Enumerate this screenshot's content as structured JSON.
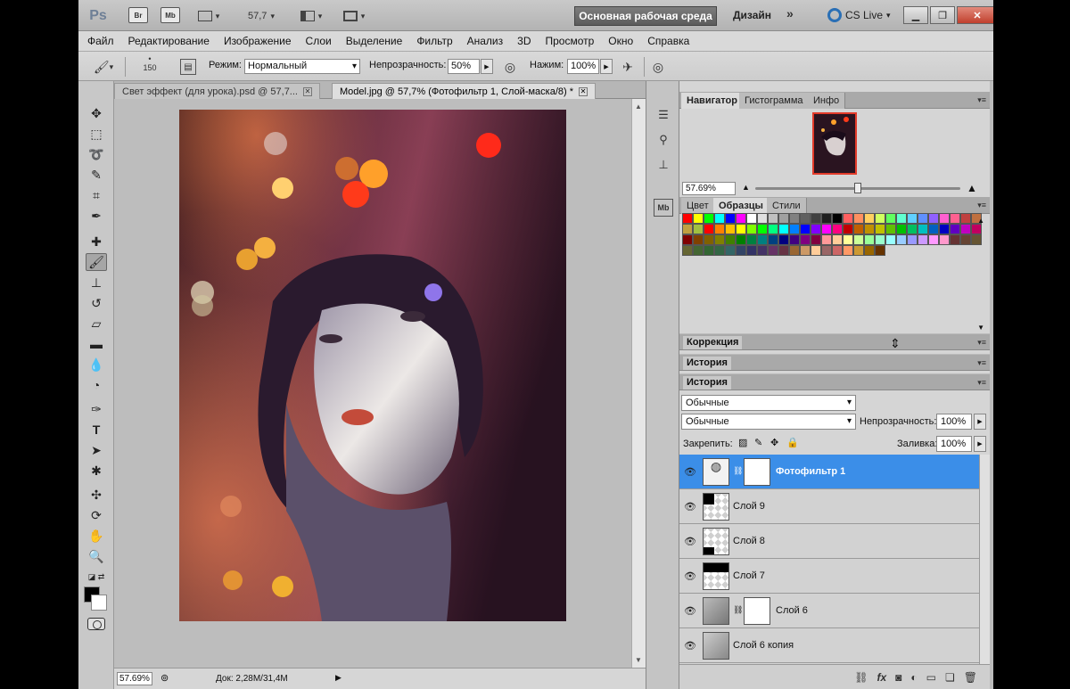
{
  "titlebar": {
    "ps_logo": "Ps",
    "br": "Br",
    "mb": "Mb",
    "zoom": "57,7",
    "workspace": "Основная рабочая среда",
    "design": "Дизайн",
    "more": "»",
    "cslive": "CS Live"
  },
  "menu": [
    "Файл",
    "Редактирование",
    "Изображение",
    "Слои",
    "Выделение",
    "Фильтр",
    "Анализ",
    "3D",
    "Просмотр",
    "Окно",
    "Справка"
  ],
  "options": {
    "brush_size": "150",
    "mode_label": "Режим:",
    "mode_value": "Нормальный",
    "opacity_label": "Непрозрачность:",
    "opacity_value": "50%",
    "flow_label": "Нажим:",
    "flow_value": "100%"
  },
  "tabs": [
    {
      "label": "Свет эффект (для урока).psd @ 57,7..."
    },
    {
      "label": "Model.jpg @ 57,7% (Фотофильтр 1, Слой-маска/8) *"
    }
  ],
  "status": {
    "zoom": "57.69%",
    "doc": "Док: 2,28M/31,4M"
  },
  "navigator": {
    "tabs": [
      "Навигатор",
      "Гистограмма",
      "Инфо"
    ],
    "zoom": "57.69%",
    "zoom_level": 0.5
  },
  "swatches_panel": {
    "tabs": [
      "Цвет",
      "Образцы",
      "Стили"
    ]
  },
  "swatch_colors": [
    "#ff0000",
    "#ffff00",
    "#00ff00",
    "#00ffff",
    "#0000ff",
    "#ff00ff",
    "#ffffff",
    "#e0e0e0",
    "#c0c0c0",
    "#a0a0a0",
    "#808080",
    "#606060",
    "#404040",
    "#202020",
    "#000000",
    "#ff6060",
    "#ff9060",
    "#ffd060",
    "#d0ff60",
    "#60ff60",
    "#60ffd0",
    "#60d0ff",
    "#6090ff",
    "#9060ff",
    "#ff60d0",
    "#ff6090",
    "#c04040",
    "#c07040",
    "#c0a040",
    "#a0c040",
    "#ff0000",
    "#ff8000",
    "#ffc000",
    "#ffff00",
    "#80ff00",
    "#00ff00",
    "#00ff80",
    "#00ffff",
    "#0080ff",
    "#0000ff",
    "#8000ff",
    "#ff00ff",
    "#ff0080",
    "#c00000",
    "#c06000",
    "#c09000",
    "#c0c000",
    "#60c000",
    "#00c000",
    "#00c060",
    "#00c0c0",
    "#0060c0",
    "#0000c0",
    "#6000c0",
    "#c000c0",
    "#c00060",
    "#800000",
    "#804000",
    "#806000",
    "#808000",
    "#408000",
    "#008000",
    "#008040",
    "#008080",
    "#004080",
    "#000080",
    "#400080",
    "#800080",
    "#800040",
    "#ff9999",
    "#ffcc99",
    "#ffff99",
    "#ccff99",
    "#99ff99",
    "#99ffcc",
    "#99ffff",
    "#99ccff",
    "#9999ff",
    "#cc99ff",
    "#ff99ff",
    "#ff99cc",
    "#663333",
    "#664433",
    "#665533",
    "#666633",
    "#446633",
    "#336633",
    "#336644",
    "#336666",
    "#334466",
    "#333366",
    "#443366",
    "#663366",
    "#663344",
    "#996633",
    "#cc9966",
    "#ffcc99",
    "#996666",
    "#cc6666",
    "#ff9966",
    "#cc9933",
    "#996600",
    "#663300"
  ],
  "panels": {
    "correction": "Коррекция",
    "history1": "История",
    "history2": "История"
  },
  "layers": {
    "blend": "Обычные",
    "mode": "Обычные",
    "opacity_label": "Непрозрачность:",
    "opacity_value": "100%",
    "lock_label": "Закрепить:",
    "fill_label": "Заливка:",
    "fill_value": "100%",
    "items": [
      {
        "name": "Фотофильтр 1"
      },
      {
        "name": "Слой 9"
      },
      {
        "name": "Слой 8"
      },
      {
        "name": "Слой 7"
      },
      {
        "name": "Слой 6"
      },
      {
        "name": "Слой 6 копия"
      }
    ]
  },
  "colors": {
    "selection": "#3b8ee8",
    "close": "#c0402d"
  }
}
